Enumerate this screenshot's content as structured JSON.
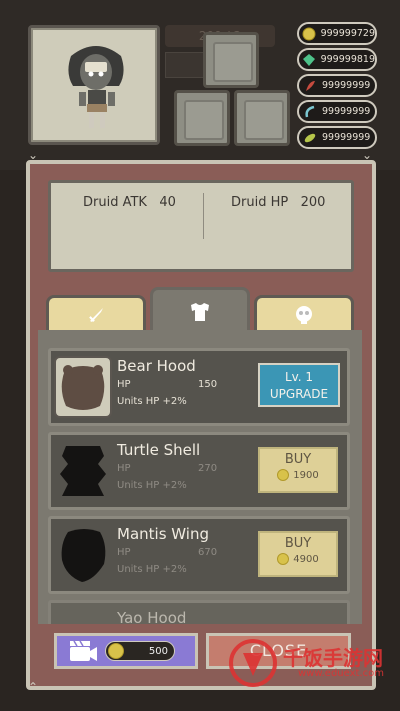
{
  "background": {
    "top_bar_text": "200 / 2"
  },
  "currency": [
    {
      "icon": "gold-coin-icon",
      "value": "999999729",
      "color": "#d8c24a"
    },
    {
      "icon": "green-gem-icon",
      "value": "999999819",
      "color": "#4ec28a"
    },
    {
      "icon": "red-feather-icon",
      "value": "99999999",
      "color": "#c64b3f"
    },
    {
      "icon": "claw-icon",
      "value": "99999999",
      "color": "#7cc7d1"
    },
    {
      "icon": "leaf-icon",
      "value": "99999999",
      "color": "#b6c64a"
    }
  ],
  "stats": {
    "atk_label": "Druid ATK",
    "atk_value": "40",
    "hp_label": "Druid HP",
    "hp_value": "200"
  },
  "tabs": [
    {
      "name": "weapon-tab",
      "icon": "sword-icon",
      "active": false
    },
    {
      "name": "armor-tab",
      "icon": "armor-icon",
      "active": true
    },
    {
      "name": "accessory-tab",
      "icon": "skull-icon",
      "active": false
    }
  ],
  "items": [
    {
      "name": "Bear Hood",
      "stat_label": "HP",
      "stat_value": "150",
      "desc": "Units HP +2%",
      "owned": true,
      "level": "Lv. 1",
      "action": "UPGRADE"
    },
    {
      "name": "Turtle Shell",
      "stat_label": "HP",
      "stat_value": "270",
      "desc": "Units HP +2%",
      "owned": false,
      "action": "BUY",
      "price": "1900"
    },
    {
      "name": "Mantis Wing",
      "stat_label": "HP",
      "stat_value": "670",
      "desc": "Units HP +2%",
      "owned": false,
      "action": "BUY",
      "price": "4900"
    },
    {
      "name": "Yao Hood",
      "owned": false
    }
  ],
  "video_reward": {
    "icon": "video-camera-icon",
    "amount": "500"
  },
  "close_label": "CLOSE",
  "watermark": {
    "text": "千饭手游网",
    "url": "www.eduext.com"
  }
}
